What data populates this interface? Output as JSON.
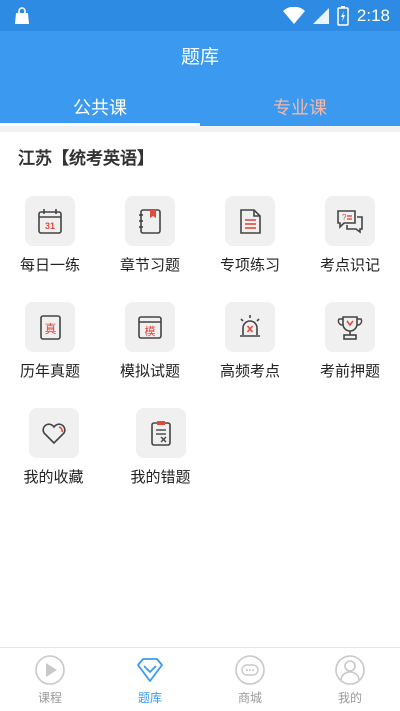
{
  "status_bar": {
    "time": "2:18"
  },
  "header": {
    "title": "题库",
    "tabs": [
      {
        "label": "公共课",
        "active": true
      },
      {
        "label": "专业课",
        "active": false
      }
    ]
  },
  "section": {
    "title": "江苏【统考英语】"
  },
  "grid": {
    "items": [
      {
        "label": "每日一练",
        "icon": "calendar-icon"
      },
      {
        "label": "章节习题",
        "icon": "notebook-icon"
      },
      {
        "label": "专项练习",
        "icon": "list-document-icon"
      },
      {
        "label": "考点识记",
        "icon": "chat-bubbles-icon"
      },
      {
        "label": "历年真题",
        "icon": "real-exam-icon",
        "glyph": "真"
      },
      {
        "label": "模拟试题",
        "icon": "mock-exam-icon",
        "glyph": "模"
      },
      {
        "label": "高频考点",
        "icon": "alarm-light-icon"
      },
      {
        "label": "考前押题",
        "icon": "trophy-icon"
      },
      {
        "label": "我的收藏",
        "icon": "heart-icon"
      },
      {
        "label": "我的错题",
        "icon": "wrong-clipboard-icon"
      }
    ]
  },
  "bottom_nav": {
    "items": [
      {
        "label": "课程",
        "icon": "play-icon",
        "active": false
      },
      {
        "label": "题库",
        "icon": "diamond-icon",
        "active": true
      },
      {
        "label": "商城",
        "icon": "chat-circle-icon",
        "active": false
      },
      {
        "label": "我的",
        "icon": "user-icon",
        "active": false
      }
    ]
  },
  "colors": {
    "primary": "#3b9af0",
    "status_bar": "#2e8be4",
    "inactive_tab": "#f2b8a8",
    "icon_red": "#e24a3b",
    "icon_dark": "#444444"
  }
}
